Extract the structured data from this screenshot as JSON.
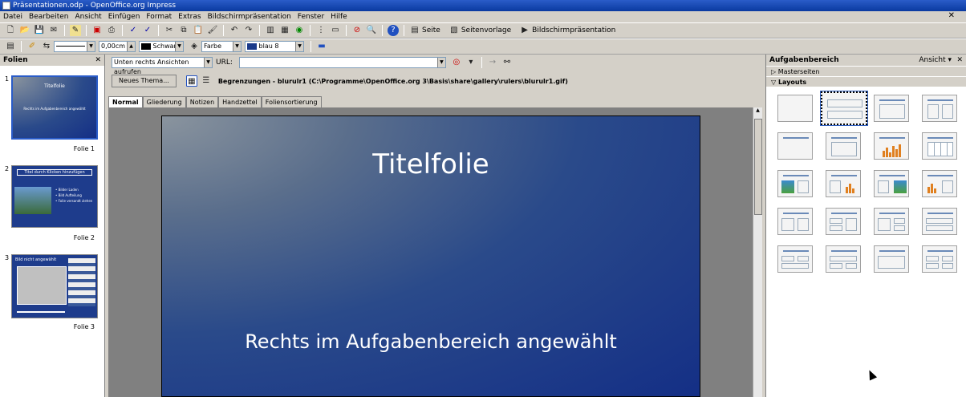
{
  "window": {
    "title": "Präsentationen.odp - OpenOffice.org Impress"
  },
  "menu": [
    "Datei",
    "Bearbeiten",
    "Ansicht",
    "Einfügen",
    "Format",
    "Extras",
    "Bildschirmpräsentation",
    "Fenster",
    "Hilfe"
  ],
  "toolbar1": {
    "seite_label": "Seite",
    "seitenvorlage_label": "Seitenvorlage",
    "bildschirm_label": "Bildschirmpräsentation"
  },
  "toolbar2": {
    "line_width": "0,00cm",
    "line_color": "Schwar",
    "fill_type": "Farbe",
    "fill_color": "blau 8"
  },
  "slides_panel": {
    "title": "Folien",
    "slides": [
      {
        "num": "1",
        "label": "Folie 1",
        "thumb_title": "Titelfolie",
        "thumb_sub": "Rechts im Aufgabenbereich angewählt"
      },
      {
        "num": "2",
        "label": "Folie 2",
        "thumb_title": "Titel durch Klicken hinzufügen",
        "thumb_bullets": [
          "• Bilder Laden",
          "• Bild Aufteilung",
          "• Folie versandt ziehen"
        ]
      },
      {
        "num": "3",
        "label": "Folie 3",
        "thumb_title": "Bild nicht angewählt"
      }
    ]
  },
  "hyperlink_bar": {
    "target": "Unten rechts Ansichten aufrufen",
    "url_label": "URL:",
    "url_value": ""
  },
  "gallery_bar": {
    "button": "Neues Thema...",
    "path": "Begrenzungen - blurulr1 (C:\\Programme\\OpenOffice.org 3\\Basis\\share\\gallery\\rulers\\blurulr1.gif)"
  },
  "view_tabs": [
    "Normal",
    "Gliederung",
    "Notizen",
    "Handzettel",
    "Foliensortierung"
  ],
  "active_view": "Normal",
  "slide": {
    "title": "Titelfolie",
    "subtitle": "Rechts im Aufgabenbereich angewählt"
  },
  "task_pane": {
    "title": "Aufgabenbereich",
    "view_label": "Ansicht",
    "sections": [
      "Masterseiten",
      "Layouts"
    ]
  },
  "colors": {
    "slide_dark": "#142f86",
    "titlebar": "#0a3aa0"
  }
}
